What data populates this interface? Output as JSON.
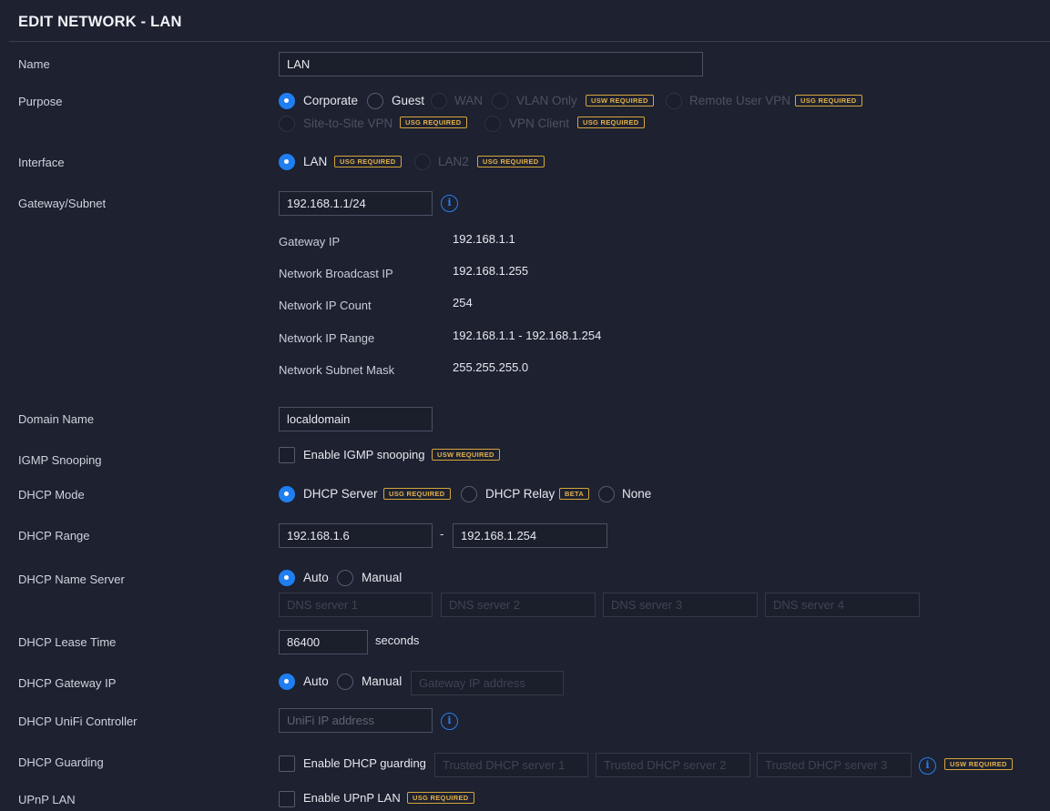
{
  "header": {
    "title": "EDIT NETWORK - LAN"
  },
  "name": {
    "label": "Name",
    "value": "LAN"
  },
  "purpose": {
    "label": "Purpose",
    "options": {
      "corporate": "Corporate",
      "guest": "Guest",
      "wan": "WAN",
      "vlan_only": "VLAN Only",
      "remote_user_vpn": "Remote User VPN",
      "site_to_site_vpn": "Site-to-Site VPN",
      "vpn_client": "VPN Client"
    },
    "selected": "Corporate"
  },
  "badges": {
    "usw_required": "USW REQUIRED",
    "usg_required": "USG REQUIRED",
    "beta": "BETA"
  },
  "interface": {
    "label": "Interface",
    "options": {
      "lan": "LAN",
      "lan2": "LAN2"
    },
    "selected": "LAN"
  },
  "gateway_subnet": {
    "label": "Gateway/Subnet",
    "value": "192.168.1.1/24",
    "info_glyph": "i",
    "details": [
      {
        "key": "Gateway IP",
        "value": "192.168.1.1"
      },
      {
        "key": "Network Broadcast IP",
        "value": "192.168.1.255"
      },
      {
        "key": "Network IP Count",
        "value": "254"
      },
      {
        "key": "Network IP Range",
        "value": "192.168.1.1 - 192.168.1.254"
      },
      {
        "key": "Network Subnet Mask",
        "value": "255.255.255.0"
      }
    ]
  },
  "domain_name": {
    "label": "Domain Name",
    "value": "localdomain"
  },
  "igmp": {
    "label": "IGMP Snooping",
    "checkbox_label": "Enable IGMP snooping",
    "checked": false
  },
  "dhcp_mode": {
    "label": "DHCP Mode",
    "options": {
      "server": "DHCP Server",
      "relay": "DHCP Relay",
      "none": "None"
    },
    "selected": "DHCP Server"
  },
  "dhcp_range": {
    "label": "DHCP Range",
    "start": "192.168.1.6",
    "separator": "-",
    "end": "192.168.1.254"
  },
  "dhcp_name_server": {
    "label": "DHCP Name Server",
    "options": {
      "auto": "Auto",
      "manual": "Manual"
    },
    "selected": "Auto",
    "placeholders": [
      "DNS server 1",
      "DNS server 2",
      "DNS server 3",
      "DNS server 4"
    ]
  },
  "dhcp_lease_time": {
    "label": "DHCP Lease Time",
    "value": "86400",
    "unit": "seconds"
  },
  "dhcp_gateway_ip": {
    "label": "DHCP Gateway IP",
    "options": {
      "auto": "Auto",
      "manual": "Manual"
    },
    "selected": "Auto",
    "placeholder": "Gateway IP address"
  },
  "dhcp_unifi_controller": {
    "label": "DHCP UniFi Controller",
    "placeholder": "UniFi IP address"
  },
  "dhcp_guarding": {
    "label": "DHCP Guarding",
    "checkbox_label": "Enable DHCP guarding",
    "checked": false,
    "placeholders": [
      "Trusted DHCP server 1",
      "Trusted DHCP server 2",
      "Trusted DHCP server 3"
    ]
  },
  "upnp_lan": {
    "label": "UPnP LAN",
    "checkbox_label": "Enable UPnP LAN",
    "checked": false
  },
  "colors": {
    "background": "#1d2130",
    "accent": "#1f7ff1",
    "badge": "#e3b14b",
    "input_border": "#4b5163"
  }
}
